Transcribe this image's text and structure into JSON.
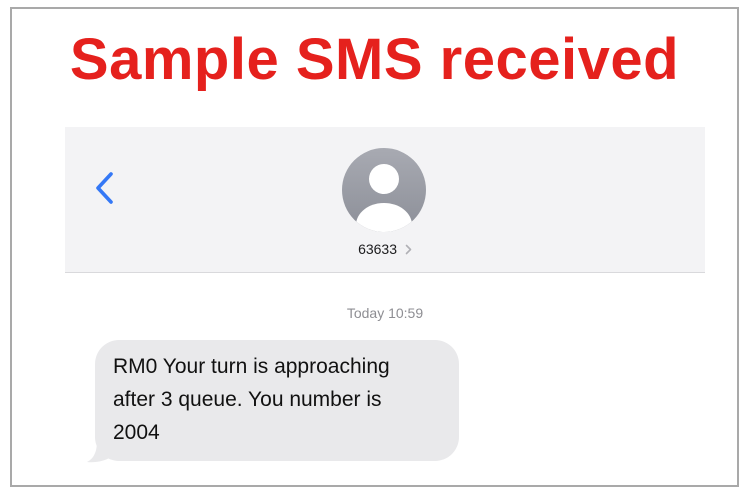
{
  "banner": {
    "text": "Sample SMS received",
    "color": "#e5211d"
  },
  "header": {
    "back_icon": "chevron-left-icon",
    "avatar_icon": "person-avatar-icon",
    "contact_number": "63633",
    "contact_chevron_icon": "chevron-right-icon"
  },
  "conversation": {
    "timestamp": "Today 10:59",
    "messages": [
      {
        "direction": "incoming",
        "lines": [
          "RM0 Your turn is approaching",
          "after 3 queue. You number is",
          "2004"
        ]
      }
    ]
  },
  "colors": {
    "accent": "#3478f6",
    "bubble_incoming": "#e9e9eb",
    "header_bg": "#f3f3f5"
  }
}
